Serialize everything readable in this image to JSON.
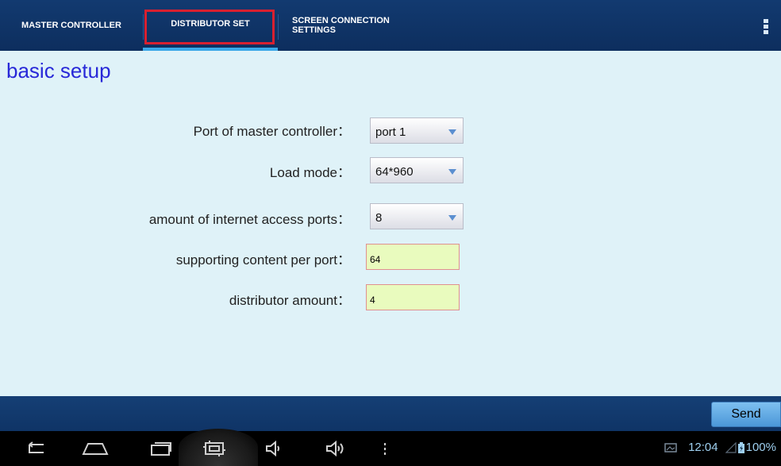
{
  "tabs": [
    {
      "label": "MASTER CONTROLLER"
    },
    {
      "label": "DISTRIBUTOR SET"
    },
    {
      "label_line1": "SCREEN CONNECTION",
      "label_line2": "SETTINGS"
    }
  ],
  "page_title": "basic setup",
  "form": {
    "port_label": "Port of master controller：",
    "port_value": "port 1",
    "load_label": "Load mode：",
    "load_value": "64*960",
    "amount_ports_label": "amount of internet access ports：",
    "amount_ports_value": "8",
    "supporting_label": "supporting content per port：",
    "supporting_value": "64",
    "distributor_label": "distributor amount：",
    "distributor_value": "4"
  },
  "send_label": "Send",
  "status": {
    "time": "12:04",
    "battery": "100%"
  },
  "colors": {
    "accent": "#3aa8e8",
    "title": "#2828d8",
    "highlight": "#d82030"
  }
}
